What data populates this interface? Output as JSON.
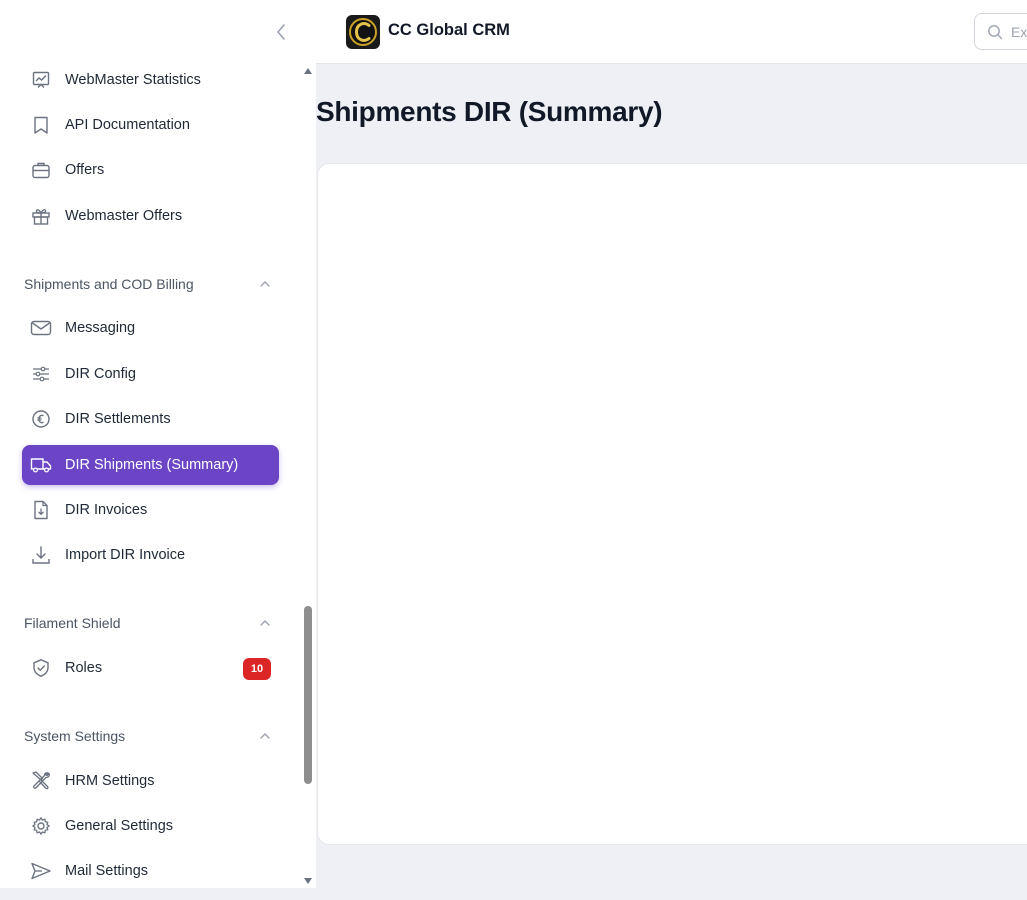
{
  "app": {
    "brand_name": "CC Global CRM",
    "search_placeholder": "Ex"
  },
  "page": {
    "title": "Shipments DIR (Summary)"
  },
  "sidebar": {
    "top_items": [
      {
        "label": "WebMaster Statistics",
        "icon": "chart-icon"
      },
      {
        "label": "API Documentation",
        "icon": "bookmark-icon"
      },
      {
        "label": "Offers",
        "icon": "briefcase-icon"
      },
      {
        "label": "Webmaster Offers",
        "icon": "gift-icon"
      }
    ],
    "groups": [
      {
        "label": "Shipments and COD Billing",
        "items": [
          {
            "label": "Messaging",
            "icon": "envelope-icon"
          },
          {
            "label": "DIR Config",
            "icon": "sliders-icon"
          },
          {
            "label": "DIR Settlements",
            "icon": "euro-icon"
          },
          {
            "label": "DIR Shipments (Summary)",
            "icon": "truck-icon",
            "active": true
          },
          {
            "label": "DIR Invoices",
            "icon": "document-download-icon"
          },
          {
            "label": "Import DIR Invoice",
            "icon": "download-icon"
          }
        ]
      },
      {
        "label": "Filament Shield",
        "items": [
          {
            "label": "Roles",
            "icon": "shield-check-icon",
            "badge": "10"
          }
        ]
      },
      {
        "label": "System Settings",
        "items": [
          {
            "label": "HRM Settings",
            "icon": "wrench-screwdriver-icon"
          },
          {
            "label": "General Settings",
            "icon": "cog-icon"
          },
          {
            "label": "Mail Settings",
            "icon": "paper-airplane-icon"
          }
        ]
      }
    ]
  },
  "colors": {
    "accent": "#6b45c6",
    "badge": "#dc2626",
    "background": "#eef0f5"
  }
}
